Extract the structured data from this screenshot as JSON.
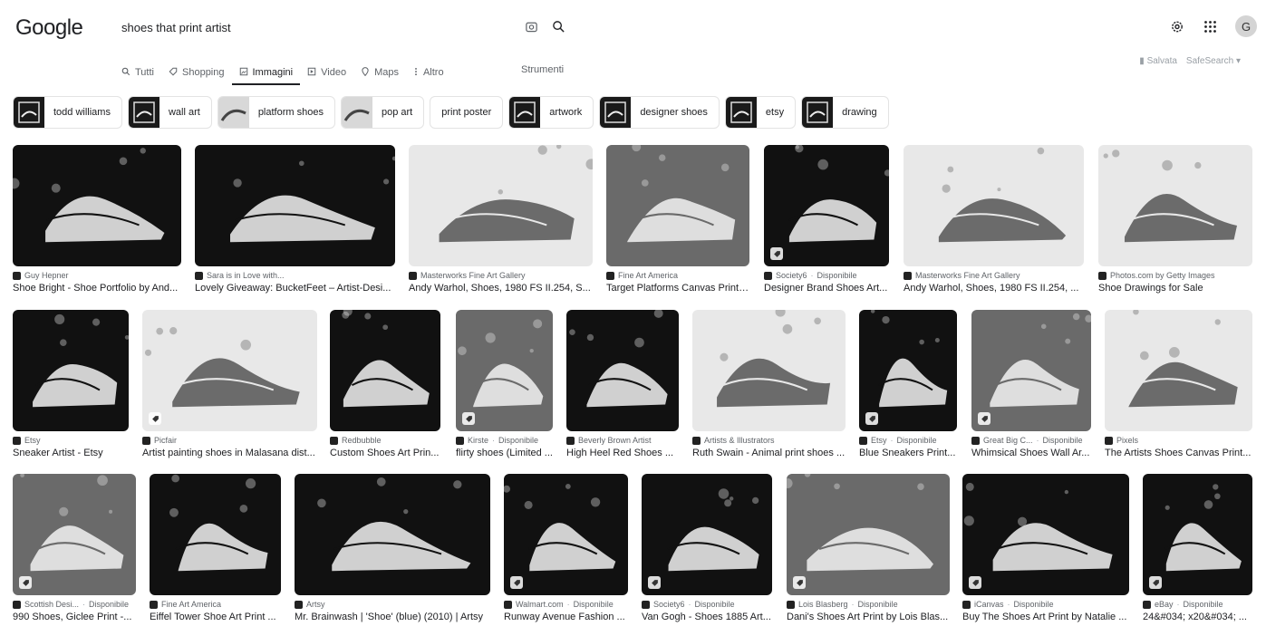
{
  "header": {
    "logo": "Google",
    "query": "shoes that print artist",
    "avatar_letter": "G"
  },
  "tabs": [
    {
      "label": "Tutti",
      "icon": "search-icon"
    },
    {
      "label": "Shopping",
      "icon": "tag-icon"
    },
    {
      "label": "Immagini",
      "icon": "image-icon",
      "active": true
    },
    {
      "label": "Video",
      "icon": "play-icon"
    },
    {
      "label": "Maps",
      "icon": "pin-icon"
    },
    {
      "label": "Altro",
      "icon": "more-icon"
    }
  ],
  "tools_label": "Strumenti",
  "right_options": {
    "saved": "Salvata",
    "safesearch": "SafeSearch"
  },
  "chips": [
    {
      "label": "todd williams",
      "thumb": "dark"
    },
    {
      "label": "wall art",
      "thumb": "dark"
    },
    {
      "label": "platform shoes",
      "thumb": "light"
    },
    {
      "label": "pop art",
      "thumb": "light"
    },
    {
      "label": "print poster",
      "thumb": "none"
    },
    {
      "label": "artwork",
      "thumb": "dark"
    },
    {
      "label": "designer shoes",
      "thumb": "dark"
    },
    {
      "label": "etsy",
      "thumb": "dark"
    },
    {
      "label": "drawing",
      "thumb": "dark"
    }
  ],
  "available_label": "Disponibile",
  "results": [
    {
      "source": "Guy Hepner",
      "title": "Shoe Bright - Shoe Portfolio by And...",
      "available": false,
      "badge": false,
      "tone": "dark"
    },
    {
      "source": "Sara is in Love with...",
      "title": "Lovely Giveaway: BucketFeet – Artist-Desi...",
      "available": false,
      "badge": false,
      "tone": "dark"
    },
    {
      "source": "Masterworks Fine Art Gallery",
      "title": "Andy Warhol, Shoes, 1980 FS II.254, S...",
      "available": false,
      "badge": false,
      "tone": "light"
    },
    {
      "source": "Fine Art America",
      "title": "Target Platforms Canvas Print ...",
      "available": false,
      "badge": false,
      "tone": "mid"
    },
    {
      "source": "Society6",
      "title": "Designer Brand Shoes Art...",
      "available": true,
      "badge": true,
      "tone": "dark"
    },
    {
      "source": "Masterworks Fine Art Gallery",
      "title": "Andy Warhol, Shoes, 1980 FS II.254, ...",
      "available": false,
      "badge": false,
      "tone": "light"
    },
    {
      "source": "Photos.com by Getty Images",
      "title": "Shoe Drawings for Sale",
      "available": false,
      "badge": false,
      "tone": "light"
    },
    {
      "source": "Etsy",
      "title": "Sneaker Artist - Etsy",
      "available": false,
      "badge": false,
      "tone": "dark"
    },
    {
      "source": "Picfair",
      "title": "Artist painting shoes in Malasana dist...",
      "available": false,
      "badge": true,
      "tone": "light"
    },
    {
      "source": "Redbubble",
      "title": "Custom Shoes Art Prin...",
      "available": false,
      "badge": false,
      "tone": "dark"
    },
    {
      "source": "Kirste",
      "title": "flirty shoes (Limited ...",
      "available": true,
      "badge": true,
      "tone": "mid"
    },
    {
      "source": "Beverly Brown Artist",
      "title": "High Heel Red Shoes ...",
      "available": false,
      "badge": false,
      "tone": "dark"
    },
    {
      "source": "Artists & Illustrators",
      "title": "Ruth Swain - Animal print shoes ...",
      "available": false,
      "badge": false,
      "tone": "light"
    },
    {
      "source": "Etsy",
      "title": "Blue Sneakers Print...",
      "available": true,
      "badge": true,
      "tone": "dark"
    },
    {
      "source": "Great Big C...",
      "title": "Whimsical Shoes Wall Ar...",
      "available": true,
      "badge": true,
      "tone": "mid"
    },
    {
      "source": "Pixels",
      "title": "The Artists Shoes Canvas Print...",
      "available": false,
      "badge": false,
      "tone": "light"
    },
    {
      "source": "Scottish Desi...",
      "title": "990 Shoes, Giclee Print -...",
      "available": true,
      "badge": true,
      "tone": "mid"
    },
    {
      "source": "Fine Art America",
      "title": "Eiffel Tower Shoe Art Print ...",
      "available": false,
      "badge": false,
      "tone": "dark"
    },
    {
      "source": "Artsy",
      "title": "Mr. Brainwash | 'Shoe' (blue) (2010) | Artsy",
      "available": false,
      "badge": false,
      "tone": "dark"
    },
    {
      "source": "Walmart.com",
      "title": "Runway Avenue Fashion ...",
      "available": true,
      "badge": true,
      "tone": "dark"
    },
    {
      "source": "Society6",
      "title": "Van Gogh - Shoes 1885 Art...",
      "available": true,
      "badge": true,
      "tone": "dark"
    },
    {
      "source": "Lois Blasberg",
      "title": "Dani's Shoes Art Print by Lois Blas...",
      "available": true,
      "badge": true,
      "tone": "mid"
    },
    {
      "source": "iCanvas",
      "title": "Buy The Shoes Art Print by Natalie ...",
      "available": true,
      "badge": true,
      "tone": "dark"
    },
    {
      "source": "eBay",
      "title": "24&#034; x20&#034; ...",
      "available": true,
      "badge": true,
      "tone": "dark"
    }
  ]
}
